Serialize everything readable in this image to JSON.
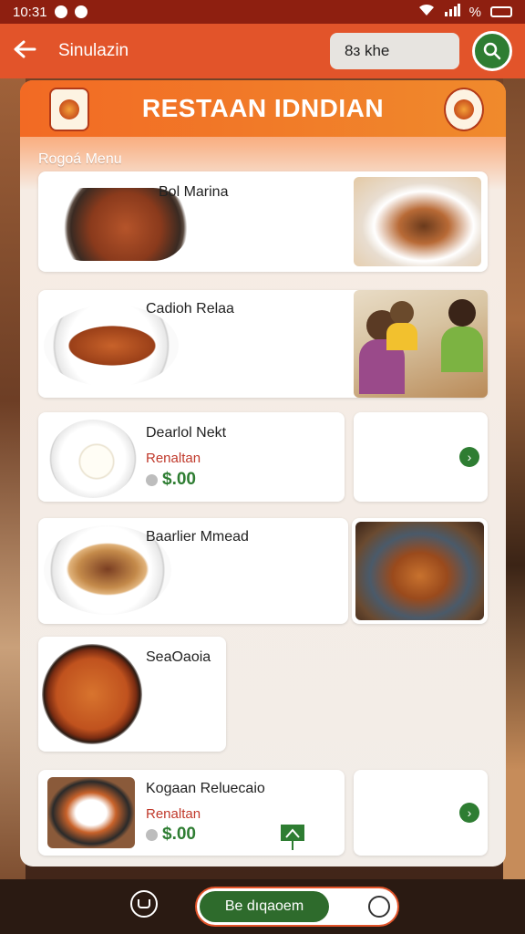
{
  "status_bar": {
    "time": "10:31",
    "battery": "%"
  },
  "app_bar": {
    "title": "Sinulazin",
    "search_value": "8ɜ khe"
  },
  "banner": {
    "title": "RESTAAN IDNDIAN"
  },
  "section": {
    "label": "Rogoá Menu"
  },
  "menu": [
    {
      "name": "Bol Marina"
    },
    {
      "name": "Cadioh Relaa"
    },
    {
      "name": "Dearlol Nekt",
      "sub": "Renaltan",
      "price": "$.00"
    },
    {
      "name": "Baarlier Mmead"
    },
    {
      "name": "SeaOaoia"
    },
    {
      "name": "Kogaan Reluecaio",
      "sub": "Renaltan",
      "price": "$.00"
    }
  ],
  "bottom": {
    "primary_button": "Be dıqaoem"
  },
  "colors": {
    "accent": "#e2542a",
    "brand_green": "#2e7d32",
    "status_bar": "#8e1f10"
  }
}
